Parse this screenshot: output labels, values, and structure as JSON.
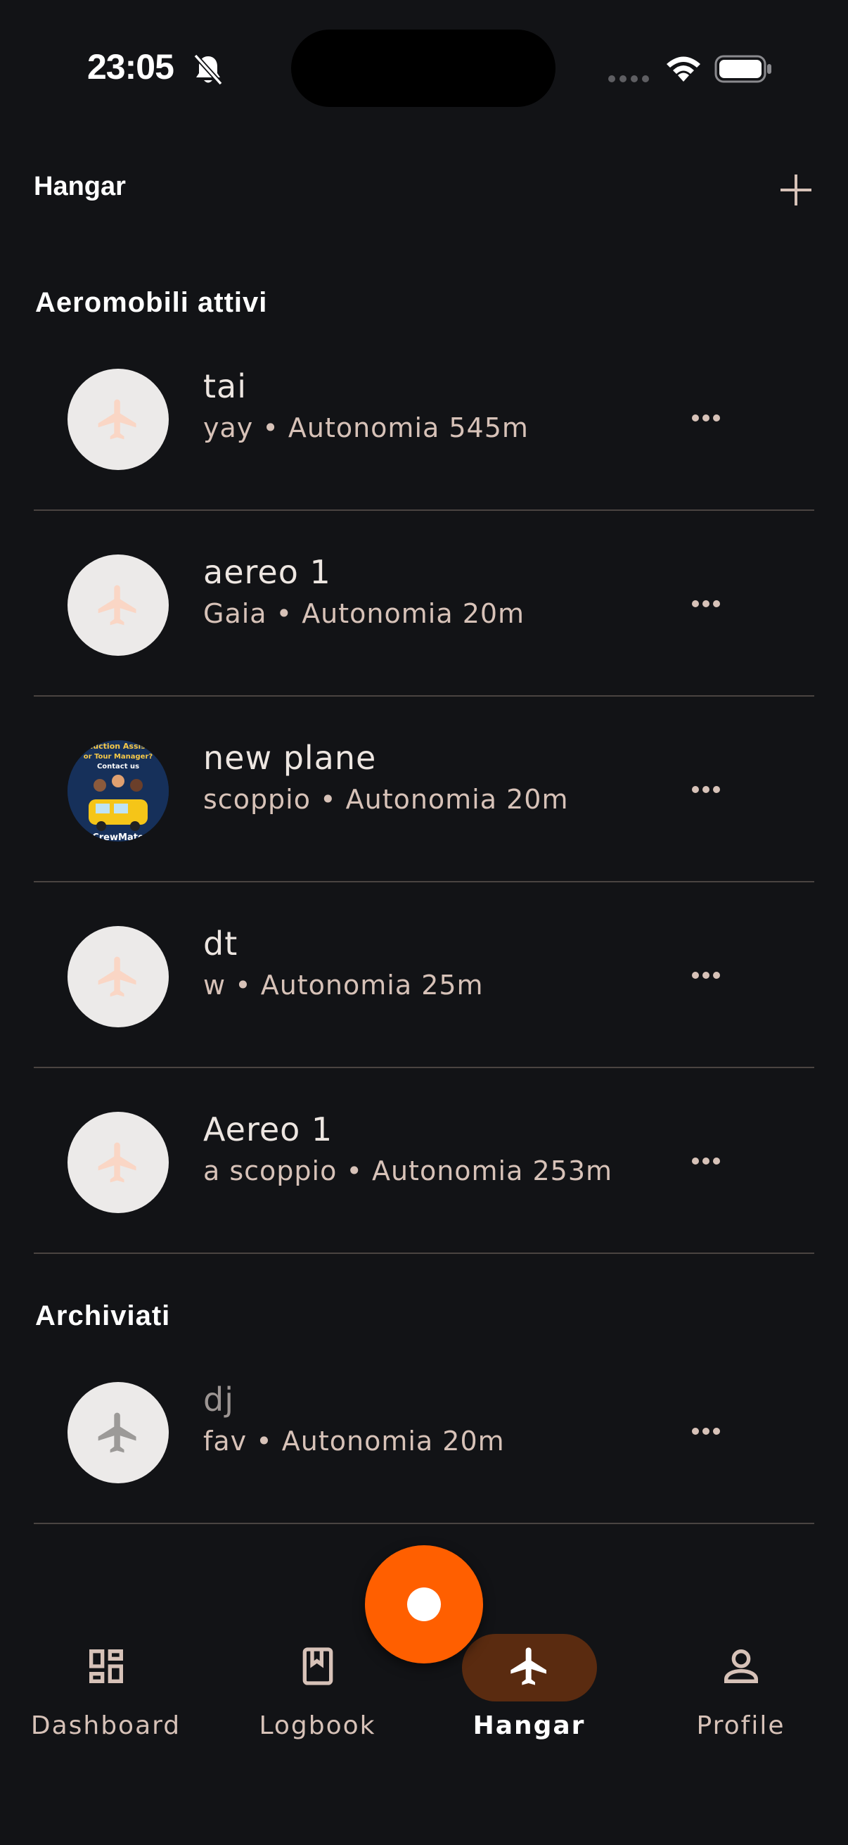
{
  "status_bar": {
    "time": "23:05"
  },
  "header": {
    "title": "Hangar",
    "add_icon": "plus-icon"
  },
  "sections": {
    "active_title": "Aeromobili attivi",
    "archived_title": "Archiviati"
  },
  "active_aircraft": [
    {
      "name": "tai",
      "owner": "yay",
      "range": "Autonomia 545m",
      "avatar": "plane-placeholder"
    },
    {
      "name": "aereo 1",
      "owner": "Gaia",
      "range": "Autonomia 20m",
      "avatar": "plane-placeholder"
    },
    {
      "name": "new plane",
      "owner": "scoppio",
      "range": "Autonomia 20m",
      "avatar": "photo",
      "photo_text": [
        "Production Assistant",
        "or Tour Manager?",
        "Contact us",
        "CrewMate"
      ]
    },
    {
      "name": "dt",
      "owner": "w",
      "range": "Autonomia 25m",
      "avatar": "plane-placeholder"
    },
    {
      "name": "Aereo 1",
      "owner": "a scoppio",
      "range": "Autonomia 253m",
      "avatar": "plane-placeholder"
    }
  ],
  "archived_aircraft": [
    {
      "name": "dj",
      "owner": "fav",
      "range": "Autonomia 20m",
      "avatar": "plane-placeholder-grey"
    }
  ],
  "separator": "•",
  "nav": {
    "items": [
      {
        "label": "Dashboard",
        "icon": "dashboard-icon",
        "active": false
      },
      {
        "label": "Logbook",
        "icon": "book-icon",
        "active": false
      },
      {
        "label": "Hangar",
        "icon": "airplane-icon",
        "active": true
      },
      {
        "label": "Profile",
        "icon": "person-icon",
        "active": false
      }
    ]
  },
  "colors": {
    "background": "#121316",
    "accent": "#FF5F00",
    "active_pill": "#5A2B10",
    "divider": "#4A4441",
    "subtitle": "#D7C2B8"
  }
}
